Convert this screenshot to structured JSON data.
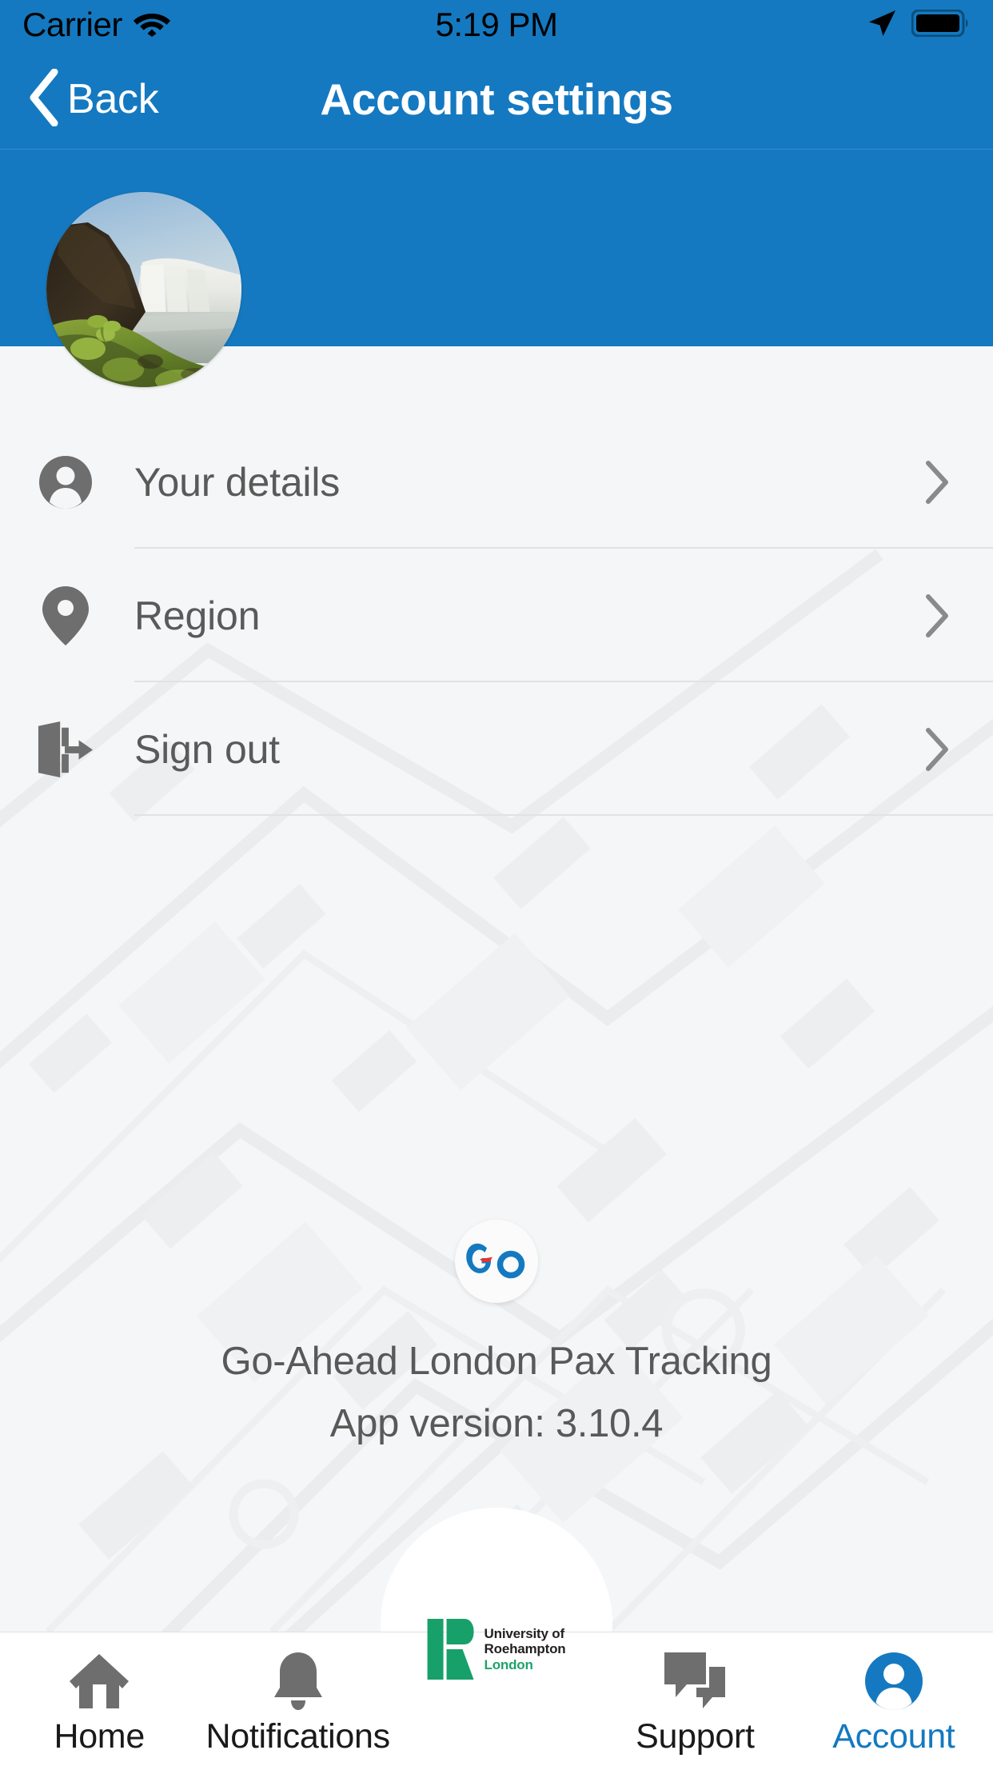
{
  "theme": {
    "brand_blue": "#1479c0",
    "content_bg": "#f5f6f7",
    "icon_gray": "#6e6e6e",
    "label_gray": "#5a5a5a",
    "divider": "#e2e2e2",
    "tab_active": "#1479c0",
    "tab_inactive": "#1a1a1a",
    "uni_green": "#1fa36a"
  },
  "status_bar": {
    "carrier": "Carrier",
    "wifi_icon": "wifi-icon",
    "time": "5:19 PM",
    "location_icon": "location-arrow-icon",
    "battery_icon": "battery-full-icon"
  },
  "nav_bar": {
    "back_icon": "chevron-left-icon",
    "back_label": "Back",
    "title": "Account settings"
  },
  "profile": {
    "avatar_name": "profile-avatar",
    "avatar_description": "waterfall landscape photo"
  },
  "menu": {
    "items": [
      {
        "id": "your-details",
        "label": "Your details",
        "icon": "person-icon",
        "chevron": "chevron-right-icon"
      },
      {
        "id": "region",
        "label": "Region",
        "icon": "map-pin-icon",
        "chevron": "chevron-right-icon"
      },
      {
        "id": "sign-out",
        "label": "Sign out",
        "icon": "sign-out-icon",
        "chevron": "chevron-right-icon"
      }
    ]
  },
  "app_info": {
    "logo_text": "Go",
    "logo_name": "go-ahead-logo",
    "app_name": "Go-Ahead London Pax Tracking",
    "version_label": "App version: 3.10.4"
  },
  "partner_logo": {
    "name": "university-of-roehampton-logo",
    "line1": "University of",
    "line2": "Roehampton",
    "line3": "London"
  },
  "tab_bar": {
    "items": [
      {
        "id": "home",
        "label": "Home",
        "icon": "home-icon",
        "active": false
      },
      {
        "id": "notifications",
        "label": "Notifications",
        "icon": "bell-icon",
        "active": false
      },
      {
        "id": "support",
        "label": "Support",
        "icon": "chat-bubbles-icon",
        "active": false
      },
      {
        "id": "account",
        "label": "Account",
        "icon": "account-circle-icon",
        "active": true
      }
    ]
  }
}
